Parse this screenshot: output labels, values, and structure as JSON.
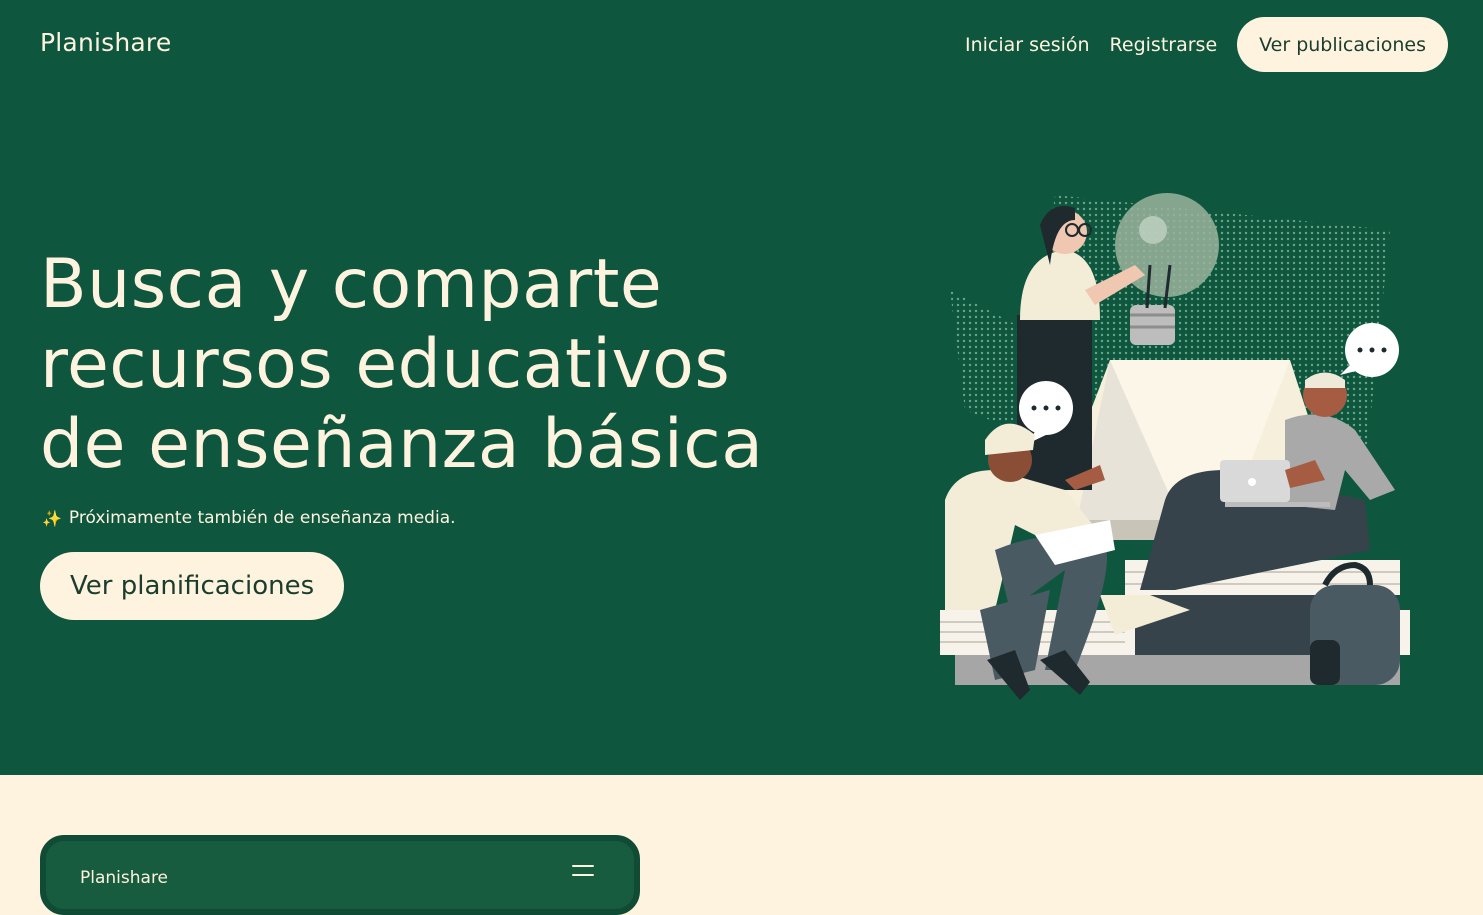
{
  "header": {
    "brand": "Planishare",
    "nav": {
      "login_label": "Iniciar sesión",
      "register_label": "Registrarse",
      "publications_label": "Ver publicaciones"
    }
  },
  "hero": {
    "headline_lines": [
      "Busca y comparte",
      "recursos educativos",
      "de enseñanza básica"
    ],
    "subtitle_icon": "✨",
    "subtitle": "Próximamente también de enseñanza media.",
    "cta_label": "Ver planificaciones",
    "illustration": "students-sharing-ideas-illustration"
  },
  "preview_card": {
    "brand": "Planishare",
    "menu_icon": "hamburger-menu-icon"
  },
  "colors": {
    "hero_bg": "#0f563e",
    "cream": "#fdf3df",
    "card_bg": "#175c3f"
  }
}
